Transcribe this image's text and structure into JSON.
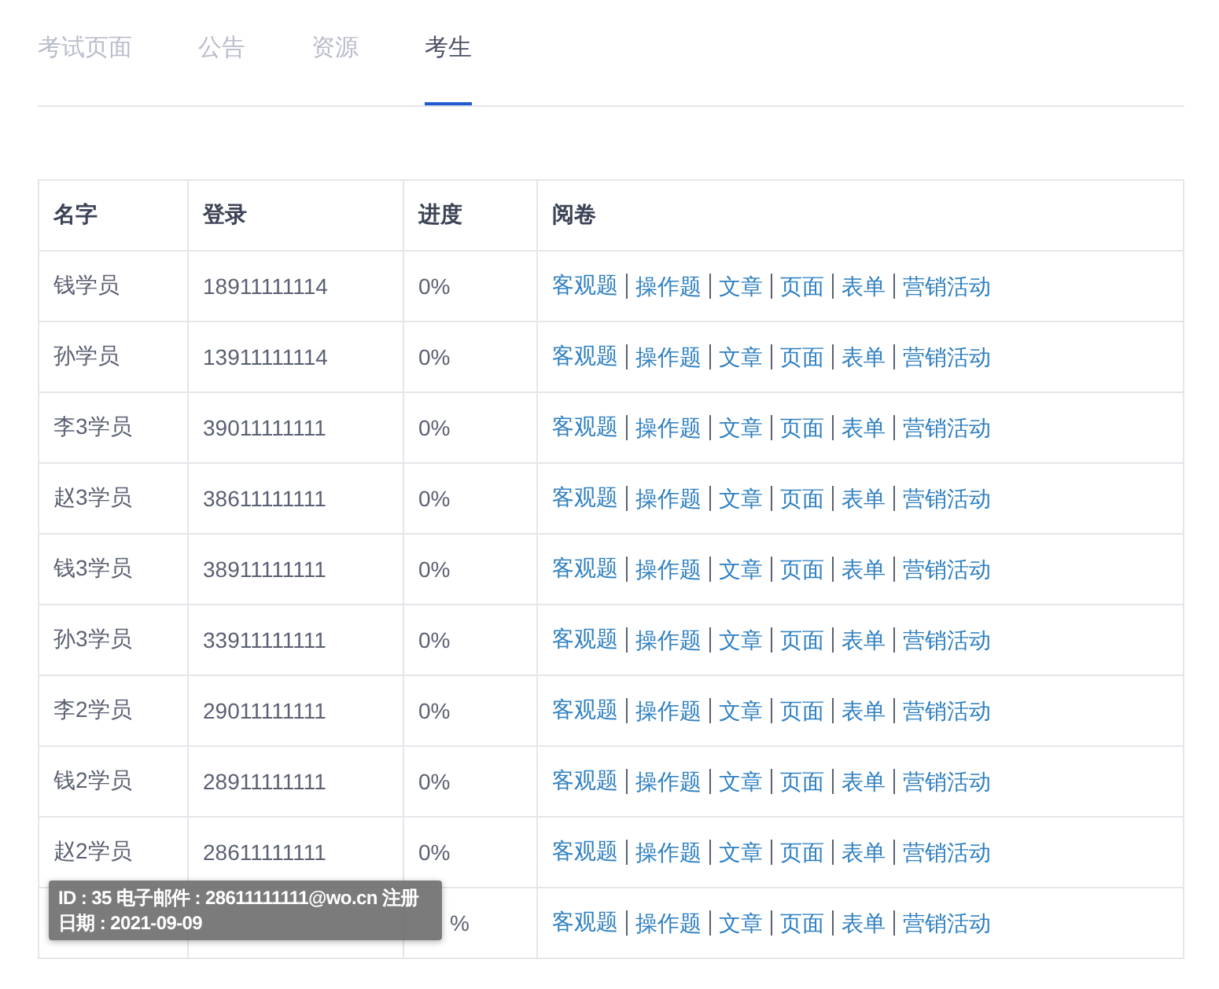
{
  "tabs": [
    {
      "label": "考试页面",
      "selected": false
    },
    {
      "label": "公告",
      "selected": false
    },
    {
      "label": "资源",
      "selected": false
    },
    {
      "label": "考生",
      "selected": true
    }
  ],
  "table": {
    "columns": [
      "名字",
      "登录",
      "进度",
      "阅卷"
    ],
    "rows": [
      {
        "name": "钱学员",
        "login": "18911111114",
        "progress": "0%",
        "actions": [
          "客观题",
          "操作题",
          "文章",
          "页面",
          "表单",
          "营销活动"
        ]
      },
      {
        "name": "孙学员",
        "login": "13911111114",
        "progress": "0%",
        "actions": [
          "客观题",
          "操作题",
          "文章",
          "页面",
          "表单",
          "营销活动"
        ]
      },
      {
        "name": "李3学员",
        "login": "39011111111",
        "progress": "0%",
        "actions": [
          "客观题",
          "操作题",
          "文章",
          "页面",
          "表单",
          "营销活动"
        ]
      },
      {
        "name": "赵3学员",
        "login": "38611111111",
        "progress": "0%",
        "actions": [
          "客观题",
          "操作题",
          "文章",
          "页面",
          "表单",
          "营销活动"
        ]
      },
      {
        "name": "钱3学员",
        "login": "38911111111",
        "progress": "0%",
        "actions": [
          "客观题",
          "操作题",
          "文章",
          "页面",
          "表单",
          "营销活动"
        ]
      },
      {
        "name": "孙3学员",
        "login": "33911111111",
        "progress": "0%",
        "actions": [
          "客观题",
          "操作题",
          "文章",
          "页面",
          "表单",
          "营销活动"
        ]
      },
      {
        "name": "李2学员",
        "login": "29011111111",
        "progress": "0%",
        "actions": [
          "客观题",
          "操作题",
          "文章",
          "页面",
          "表单",
          "营销活动"
        ]
      },
      {
        "name": "钱2学员",
        "login": "28911111111",
        "progress": "0%",
        "actions": [
          "客观题",
          "操作题",
          "文章",
          "页面",
          "表单",
          "营销活动"
        ]
      },
      {
        "name": "赵2学员",
        "login": "28611111111",
        "progress": "0%",
        "actions": [
          "客观题",
          "操作题",
          "文章",
          "页面",
          "表单",
          "营销活动"
        ]
      },
      {
        "progress": "%",
        "actions": [
          "客观题",
          "操作题",
          "文章",
          "页面",
          "表单",
          "营销活动"
        ]
      }
    ]
  },
  "tooltip": {
    "text": "ID : 35 电子邮件 : 28611111111@wo.cn 注册日期 : 2021-09-09"
  }
}
